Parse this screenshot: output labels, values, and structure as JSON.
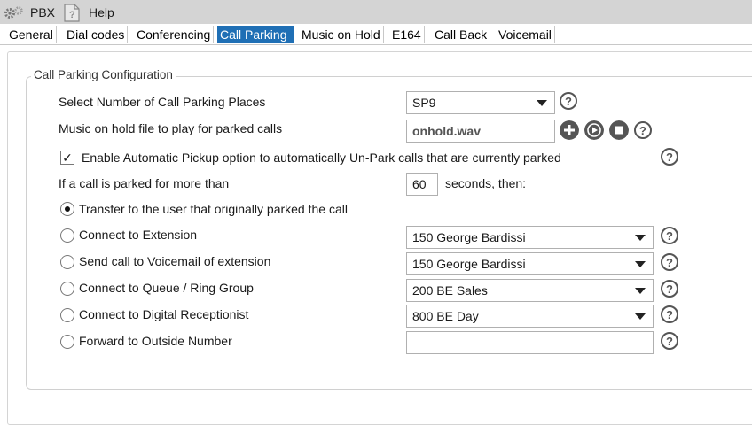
{
  "menu": {
    "pbx": "PBX",
    "help": "Help"
  },
  "tabs": [
    "General",
    "Dial codes",
    "Conferencing",
    "Call Parking",
    "Music on Hold",
    "E164",
    "Call Back",
    "Voicemail"
  ],
  "active_tab": "Call Parking",
  "group": {
    "legend": "Call Parking Configuration",
    "places_label": "Select Number of Call Parking Places",
    "places_value": "SP9",
    "music_label": "Music on hold file to play for parked calls",
    "music_value": "onhold.wav",
    "auto_pickup_label": "Enable Automatic Pickup option to automatically Un-Park calls that are currently parked",
    "auto_pickup_checked": true,
    "timeout_prefix": "If a call is parked for more than",
    "timeout_value": "60",
    "timeout_suffix": "seconds, then:",
    "options": [
      {
        "label": "Transfer to the user that originally parked the call",
        "selected": true,
        "value": null
      },
      {
        "label": "Connect to Extension",
        "selected": false,
        "value": "150 George Bardissi"
      },
      {
        "label": "Send call to Voicemail of extension",
        "selected": false,
        "value": "150 George Bardissi"
      },
      {
        "label": "Connect to Queue / Ring Group",
        "selected": false,
        "value": "200 BE Sales"
      },
      {
        "label": "Connect to Digital Receptionist",
        "selected": false,
        "value": "800 BE Day"
      },
      {
        "label": "Forward to Outside Number",
        "selected": false,
        "value": ""
      }
    ],
    "help_glyph": "?"
  },
  "icons": {
    "pbx": "gear-icon",
    "help": "help-document-icon",
    "add": "plus-icon",
    "play": "play-icon",
    "stop": "stop-icon"
  },
  "colors": {
    "active_tab": "#1f6fb5",
    "menubar": "#d4d4d4"
  }
}
